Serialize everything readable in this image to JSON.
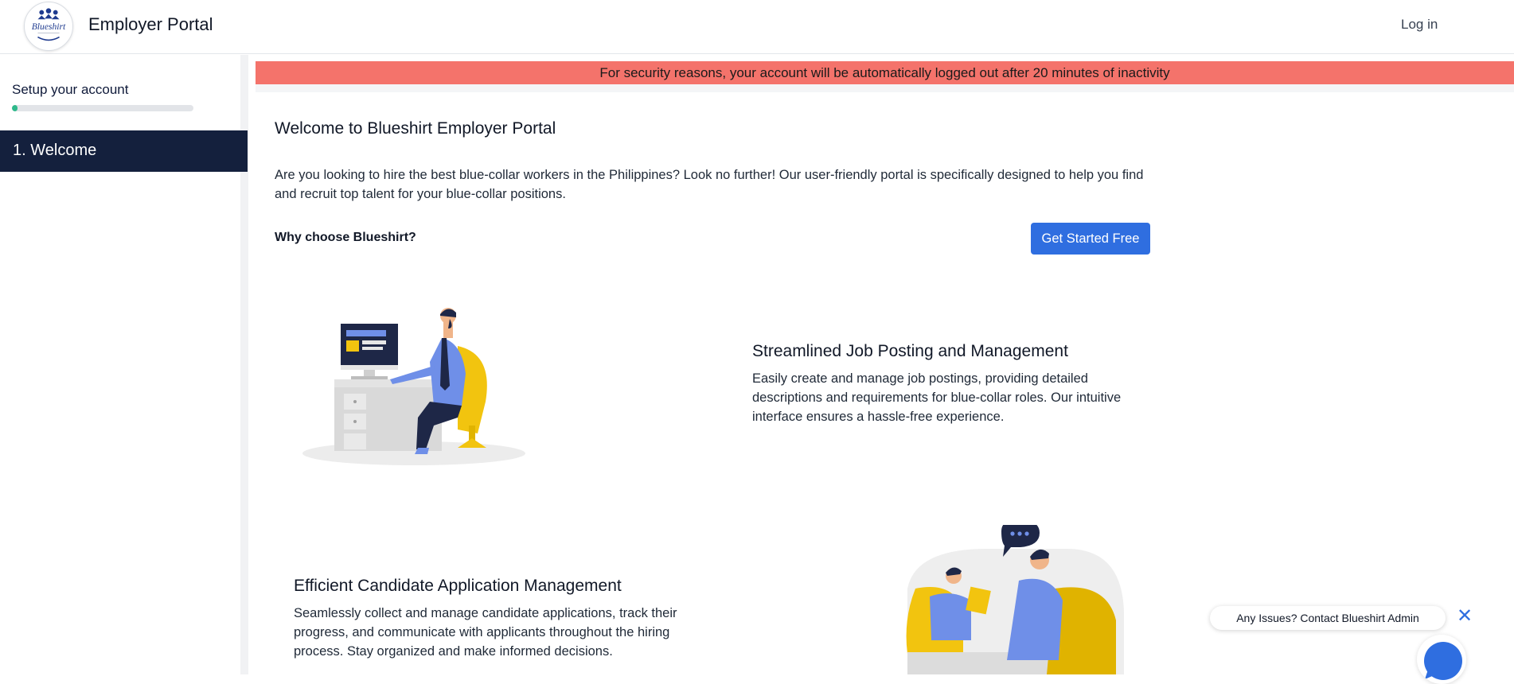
{
  "header": {
    "logo_text": "Blueshirt",
    "title": "Employer Portal",
    "login_label": "Log in"
  },
  "sidebar": {
    "setup_label": "Setup your account",
    "progress_fraction": 0.03,
    "items": [
      {
        "label": "1. Welcome",
        "active": true
      }
    ]
  },
  "banner": {
    "text": "For security reasons, your account will be automatically logged out after 20 minutes of inactivity",
    "color": "#f4736b"
  },
  "main": {
    "title": "Welcome to Blueshirt Employer Portal",
    "intro": "Are you looking to hire the best blue-collar workers in the Philippines? Look no further! Our user-friendly portal is specifically designed to help you find and recruit top talent for your blue-collar positions.",
    "why_label": "Why choose Blueshirt?",
    "cta_label": "Get Started Free",
    "features": [
      {
        "title": "Streamlined Job Posting and Management",
        "description": "Easily create and manage job postings, providing detailed descriptions and requirements for blue-collar roles. Our intuitive interface ensures a hassle-free experience.",
        "illustration": "worker-at-desk-illustration"
      },
      {
        "title": "Efficient Candidate Application Management",
        "description": "Seamlessly collect and manage candidate applications, track their progress, and communicate with applicants throughout the hiring process. Stay organized and make informed decisions.",
        "illustration": "interview-illustration"
      }
    ]
  },
  "chat": {
    "prompt": "Any Issues? Contact Blueshirt Admin",
    "close_icon": "close-icon",
    "fab_icon": "chat-bubble-icon"
  },
  "colors": {
    "primary": "#2f6ee0",
    "sidebar_active": "#14203d",
    "progress": "#2fb98b",
    "illustration_yellow": "#f2c40f",
    "illustration_blue": "#6f8fe8"
  }
}
